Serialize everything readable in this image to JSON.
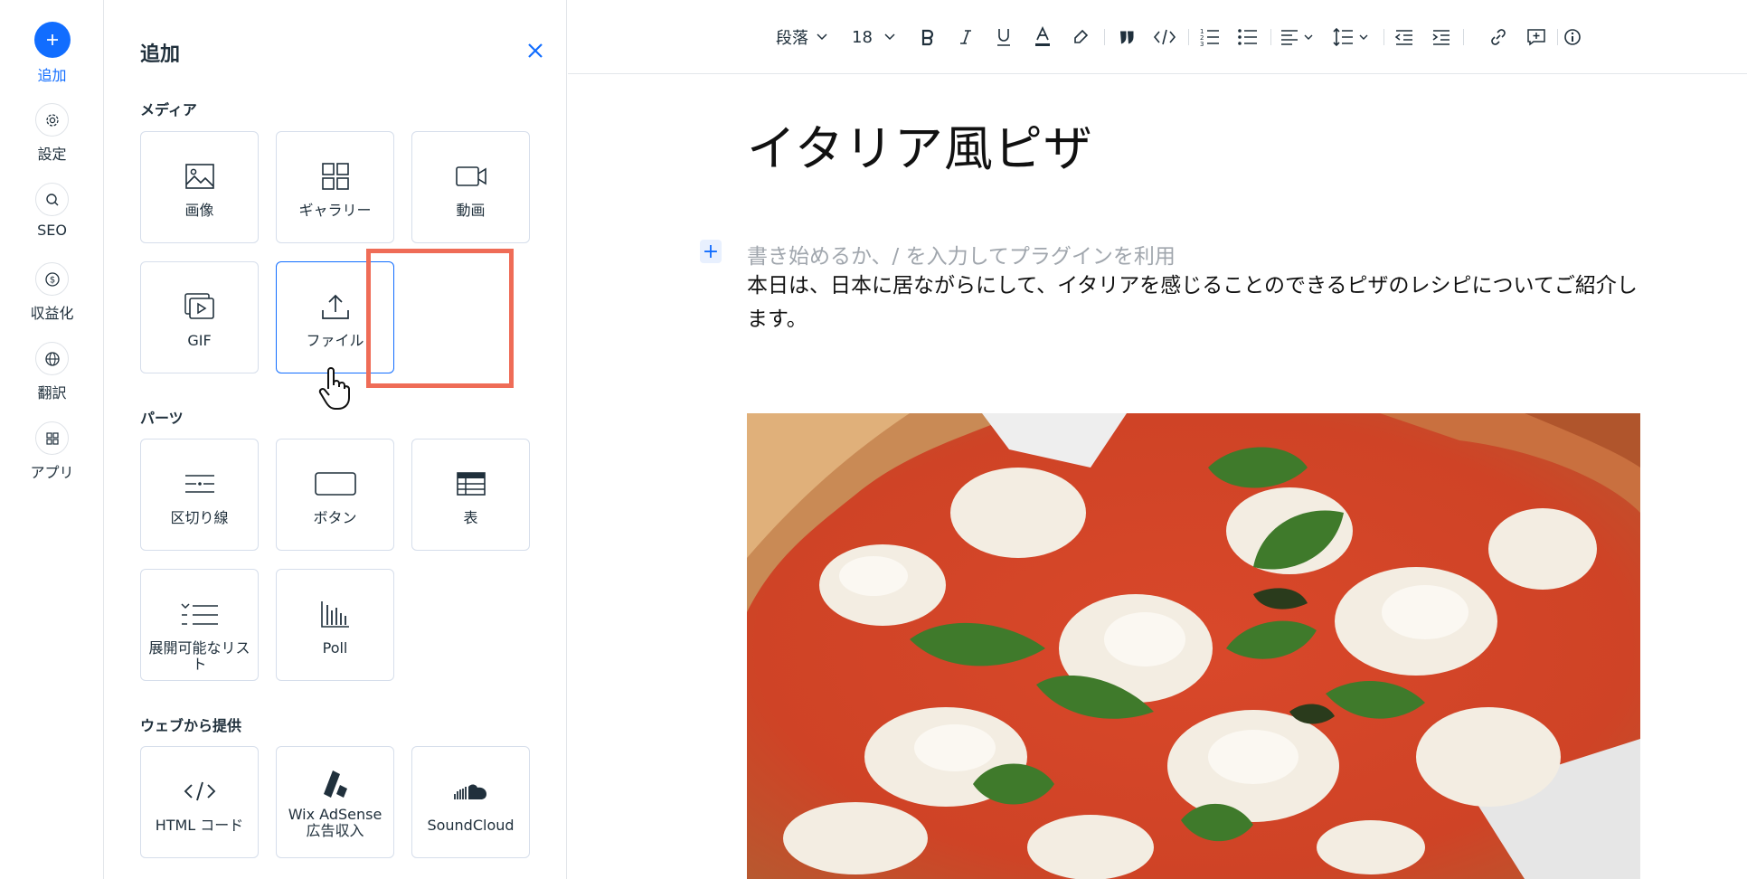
{
  "rail": {
    "items": [
      {
        "label": "追加",
        "icon": "plus-icon",
        "active": true
      },
      {
        "label": "設定",
        "icon": "gear-icon"
      },
      {
        "label": "SEO",
        "icon": "search-icon"
      },
      {
        "label": "収益化",
        "icon": "dollar-icon"
      },
      {
        "label": "翻訳",
        "icon": "globe-icon"
      },
      {
        "label": "アプリ",
        "icon": "apps-icon"
      }
    ]
  },
  "panel": {
    "title": "追加",
    "sections": {
      "media": {
        "title": "メディア",
        "tiles": [
          {
            "label": "画像",
            "icon": "image-icon"
          },
          {
            "label": "ギャラリー",
            "icon": "gallery-icon"
          },
          {
            "label": "動画",
            "icon": "video-icon"
          },
          {
            "label": "GIF",
            "icon": "gif-icon"
          },
          {
            "label": "ファイル",
            "icon": "upload-icon",
            "highlighted": true
          }
        ]
      },
      "parts": {
        "title": "パーツ",
        "tiles": [
          {
            "label": "区切り線",
            "icon": "divider-icon"
          },
          {
            "label": "ボタン",
            "icon": "button-icon"
          },
          {
            "label": "表",
            "icon": "table-icon"
          },
          {
            "label": "展開可能なリスト",
            "icon": "collapsible-list-icon"
          },
          {
            "label": "Poll",
            "icon": "poll-icon"
          }
        ]
      },
      "web": {
        "title": "ウェブから提供",
        "tiles": [
          {
            "label": "HTML コード",
            "icon": "code-icon"
          },
          {
            "label": "Wix AdSense 広告収入",
            "icon": "adsense-icon"
          },
          {
            "label": "SoundCloud",
            "icon": "soundcloud-icon"
          }
        ]
      }
    }
  },
  "toolbar": {
    "paragraph_style": "段落",
    "font_size": "18"
  },
  "editor": {
    "title": "イタリア風ピザ",
    "placeholder": "書き始めるか、/ を入力してプラグインを利用",
    "body": "本日は、日本に居ながらにして、イタリアを感じることのできるピザのレシピについてご紹介します。"
  },
  "colors": {
    "accent": "#116dff",
    "highlight": "#ef6c57"
  }
}
